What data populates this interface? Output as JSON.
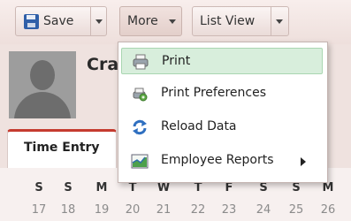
{
  "toolbar": {
    "save_label": "Save",
    "more_label": "More",
    "listview_label": "List View"
  },
  "header": {
    "name_partial": "Cra"
  },
  "menu": {
    "items": [
      {
        "label": "Print",
        "icon": "printer-icon"
      },
      {
        "label": "Print Preferences",
        "icon": "print-preferences-icon"
      },
      {
        "label": "Reload Data",
        "icon": "refresh-icon"
      },
      {
        "label": "Employee Reports",
        "icon": "report-chart-icon"
      }
    ]
  },
  "tabs": {
    "active": "Time Entry"
  },
  "calendar": {
    "weekdays": [
      "S",
      "S",
      "M",
      "T",
      "W",
      "T",
      "F",
      "S",
      "S",
      "M"
    ],
    "dates": [
      "17",
      "18",
      "19",
      "20",
      "21",
      "22",
      "23",
      "24",
      "25",
      "26"
    ]
  }
}
